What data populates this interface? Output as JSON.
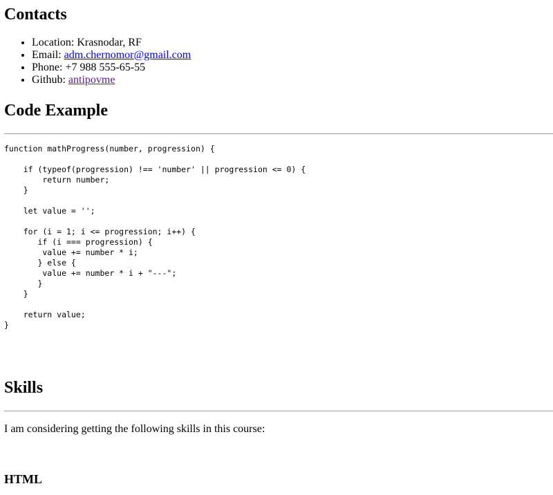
{
  "contacts": {
    "heading": "Contacts",
    "location": {
      "label": "Location: ",
      "value": "Krasnodar, RF"
    },
    "email": {
      "label": "Email: ",
      "value": "adm.chernomor@gmail.com"
    },
    "phone": {
      "label": "Phone: ",
      "value": "+7 988 555-65-55"
    },
    "github": {
      "label": "Github: ",
      "value": "antipovme"
    }
  },
  "code_example": {
    "heading": "Code Example",
    "code": "function mathProgress(number, progression) {\n\n    if (typeof(progression) !== 'number' || progression <= 0) {\n        return number;\n    }\n\n    let value = '';\n\n    for (i = 1; i <= progression; i++) {\n       if (i === progression) {\n        value += number * i;\n       } else {\n        value += number * i + \"---\";\n       }\n    }\n\n    return value;\n}"
  },
  "skills": {
    "heading": "Skills",
    "intro": "I am considering getting the following skills in this course:",
    "first_subheading": "HTML"
  }
}
